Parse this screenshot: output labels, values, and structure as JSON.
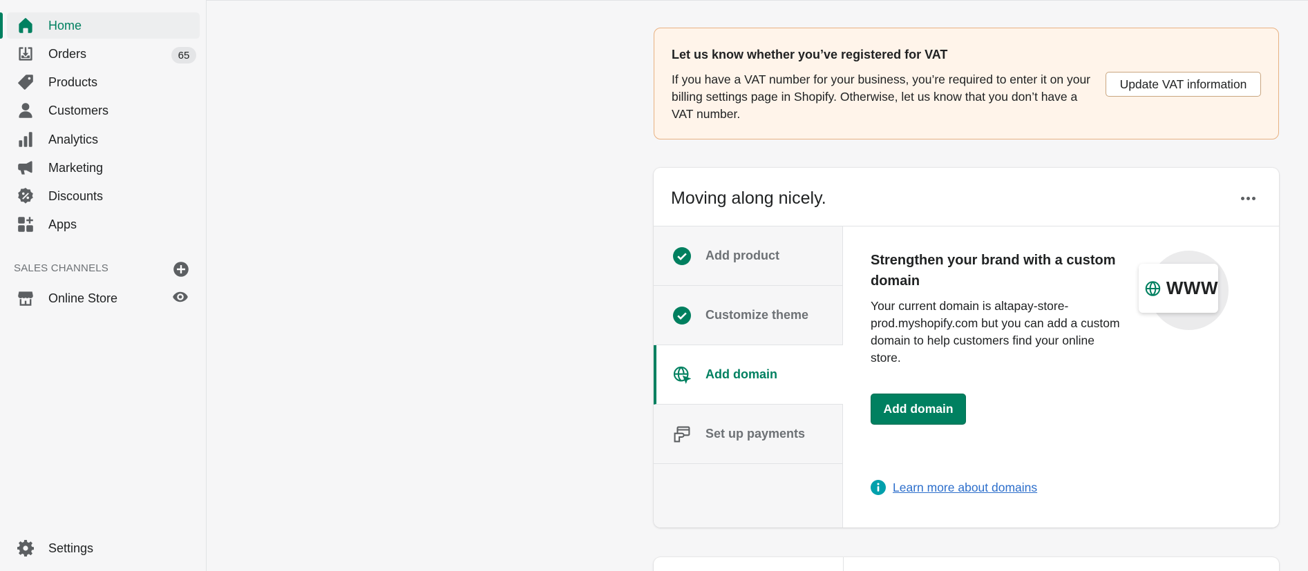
{
  "sidebar": {
    "items": [
      {
        "label": "Home",
        "icon": "home-icon",
        "active": true
      },
      {
        "label": "Orders",
        "icon": "orders-icon",
        "badge": "65"
      },
      {
        "label": "Products",
        "icon": "tag-icon"
      },
      {
        "label": "Customers",
        "icon": "person-icon"
      },
      {
        "label": "Analytics",
        "icon": "bar-chart-icon"
      },
      {
        "label": "Marketing",
        "icon": "megaphone-icon"
      },
      {
        "label": "Discounts",
        "icon": "discount-icon"
      },
      {
        "label": "Apps",
        "icon": "apps-icon"
      }
    ],
    "sales_channels_label": "SALES CHANNELS",
    "online_store_label": "Online Store",
    "settings_label": "Settings"
  },
  "vat_banner": {
    "title": "Let us know whether you’ve registered for VAT",
    "body": "If you have a VAT number for your business, you’re required to enter it on your billing settings page in Shopify. Otherwise, let us know that you don’t have a VAT number.",
    "button_label": "Update VAT information"
  },
  "setup_card": {
    "title": "Moving along nicely.",
    "steps": [
      {
        "label": "Add product",
        "status": "complete"
      },
      {
        "label": "Customize theme",
        "status": "complete"
      },
      {
        "label": "Add domain",
        "status": "active"
      },
      {
        "label": "Set up payments",
        "status": "pending"
      }
    ],
    "detail": {
      "title": "Strengthen your brand with a custom domain",
      "body": "Your current domain is altapay-store-prod.myshopify.com but you can add a custom domain to help customers find your online store.",
      "button_label": "Add domain",
      "learn_more": "Learn more about domains",
      "illustration_text": "WWW"
    }
  },
  "colors": {
    "accent": "#008060",
    "banner_bg": "#fff4ea",
    "link": "#2c6ecb",
    "info": "#00a0ac"
  }
}
